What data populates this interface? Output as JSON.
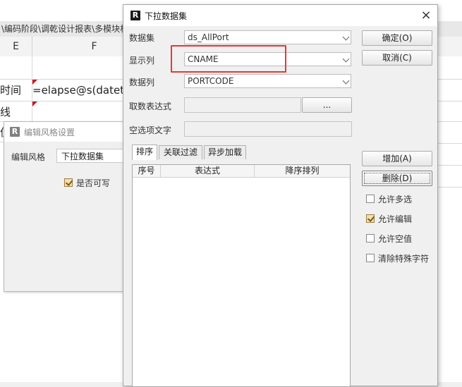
{
  "background_sheet": {
    "path_text": "\\编码阶段\\调乾设计报表\\多模块相",
    "col_e": "E",
    "col_f": "F",
    "row1_left": "时间",
    "row1_formula": "=elapse@s(datetim",
    "row2_left": "线",
    "row3_left": "值"
  },
  "style_dialog": {
    "title": "编辑风格设置",
    "style_label": "编辑风格",
    "style_value": "下拉数据集",
    "writable_label": "是否可写",
    "writable_checked": true
  },
  "dialog": {
    "title": "下拉数据集",
    "close": "×",
    "dataset_label": "数据集",
    "dataset_value": "ds_AllPort",
    "display_col_label": "显示列",
    "display_col_value": "CNAME",
    "data_col_label": "数据列",
    "data_col_value": "PORTCODE",
    "fetch_expr_label": "取数表达式",
    "fetch_expr_value": "",
    "ellipsis": "...",
    "empty_text_label": "空选项文字",
    "empty_text_value": "",
    "ok": "确定(O)",
    "cancel": "取消(C)",
    "tabs": [
      "排序",
      "关联过滤",
      "异步加载"
    ],
    "grid_headers": [
      "序号",
      "表达式",
      "降序排列"
    ],
    "add": "增加(A)",
    "delete": "删除(D)",
    "options": [
      {
        "label": "允许多选",
        "checked": false
      },
      {
        "label": "允许编辑",
        "checked": true
      },
      {
        "label": "允许空值",
        "checked": false
      },
      {
        "label": "清除特殊字符",
        "checked": false
      }
    ]
  },
  "colors": {
    "highlight": "#e53935",
    "flag": "#d0161b"
  }
}
